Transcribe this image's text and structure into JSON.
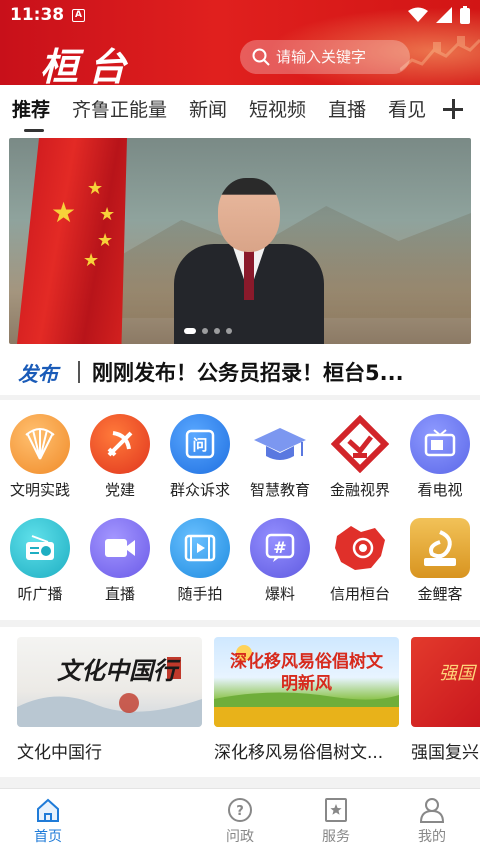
{
  "status_bar": {
    "time": "11:38",
    "app_badge": "A"
  },
  "header": {
    "logo_text": "桓台",
    "search_placeholder": "请输入关键字"
  },
  "tabs": [
    {
      "label": "推荐",
      "active": true
    },
    {
      "label": "齐鲁正能量",
      "active": false
    },
    {
      "label": "新闻",
      "active": false
    },
    {
      "label": "短视频",
      "active": false
    },
    {
      "label": "直播",
      "active": false
    },
    {
      "label": "看见",
      "active": false
    }
  ],
  "banner": {
    "slide_count": 4,
    "active_slide": 1
  },
  "news_ticker": {
    "tag": "发布",
    "text": "刚刚发布！公务员招录！桓台5..."
  },
  "grid": [
    {
      "label": "文明实践",
      "icon": "fan-icon",
      "color": "#f39a3a"
    },
    {
      "label": "党建",
      "icon": "party-icon",
      "color": "#e8452a"
    },
    {
      "label": "群众诉求",
      "icon": "question-icon",
      "color": "#2f7fe6"
    },
    {
      "label": "智慧教育",
      "icon": "graduation-cap-icon",
      "color": "#5f7fe0"
    },
    {
      "label": "金融视界",
      "icon": "finance-icon",
      "color": "#d2252a"
    },
    {
      "label": "看电视",
      "icon": "tv-icon",
      "color": "#6a78ee"
    },
    {
      "label": "听广播",
      "icon": "radio-icon",
      "color": "#2ab8c9"
    },
    {
      "label": "直播",
      "icon": "video-camera-icon",
      "color": "#7a6cf0"
    },
    {
      "label": "随手拍",
      "icon": "film-icon",
      "color": "#2f9ee8"
    },
    {
      "label": "爆料",
      "icon": "hashtag-icon",
      "color": "#6d6ce8"
    },
    {
      "label": "信用桓台",
      "icon": "map-icon",
      "color": "#e0302a"
    },
    {
      "label": "金鲤客",
      "icon": "carp-icon",
      "color": "#e0a030"
    }
  ],
  "cards": [
    {
      "title": "文化中国行",
      "image_text": "文化中国行"
    },
    {
      "title": "深化移风易俗倡树文...",
      "image_text": "深化移风易俗倡树文明新风"
    },
    {
      "title": "强国复兴",
      "image_text": "强国"
    }
  ],
  "bottom_nav": [
    {
      "label": "首页",
      "icon": "home-icon",
      "active": true
    },
    {
      "label": "问政",
      "icon": "question-circle-icon",
      "active": false
    },
    {
      "label": "服务",
      "icon": "bookmark-star-icon",
      "active": false
    },
    {
      "label": "我的",
      "icon": "user-icon",
      "active": false
    }
  ],
  "colors": {
    "brand_red": "#d21515",
    "accent_blue": "#1f7bd8"
  }
}
